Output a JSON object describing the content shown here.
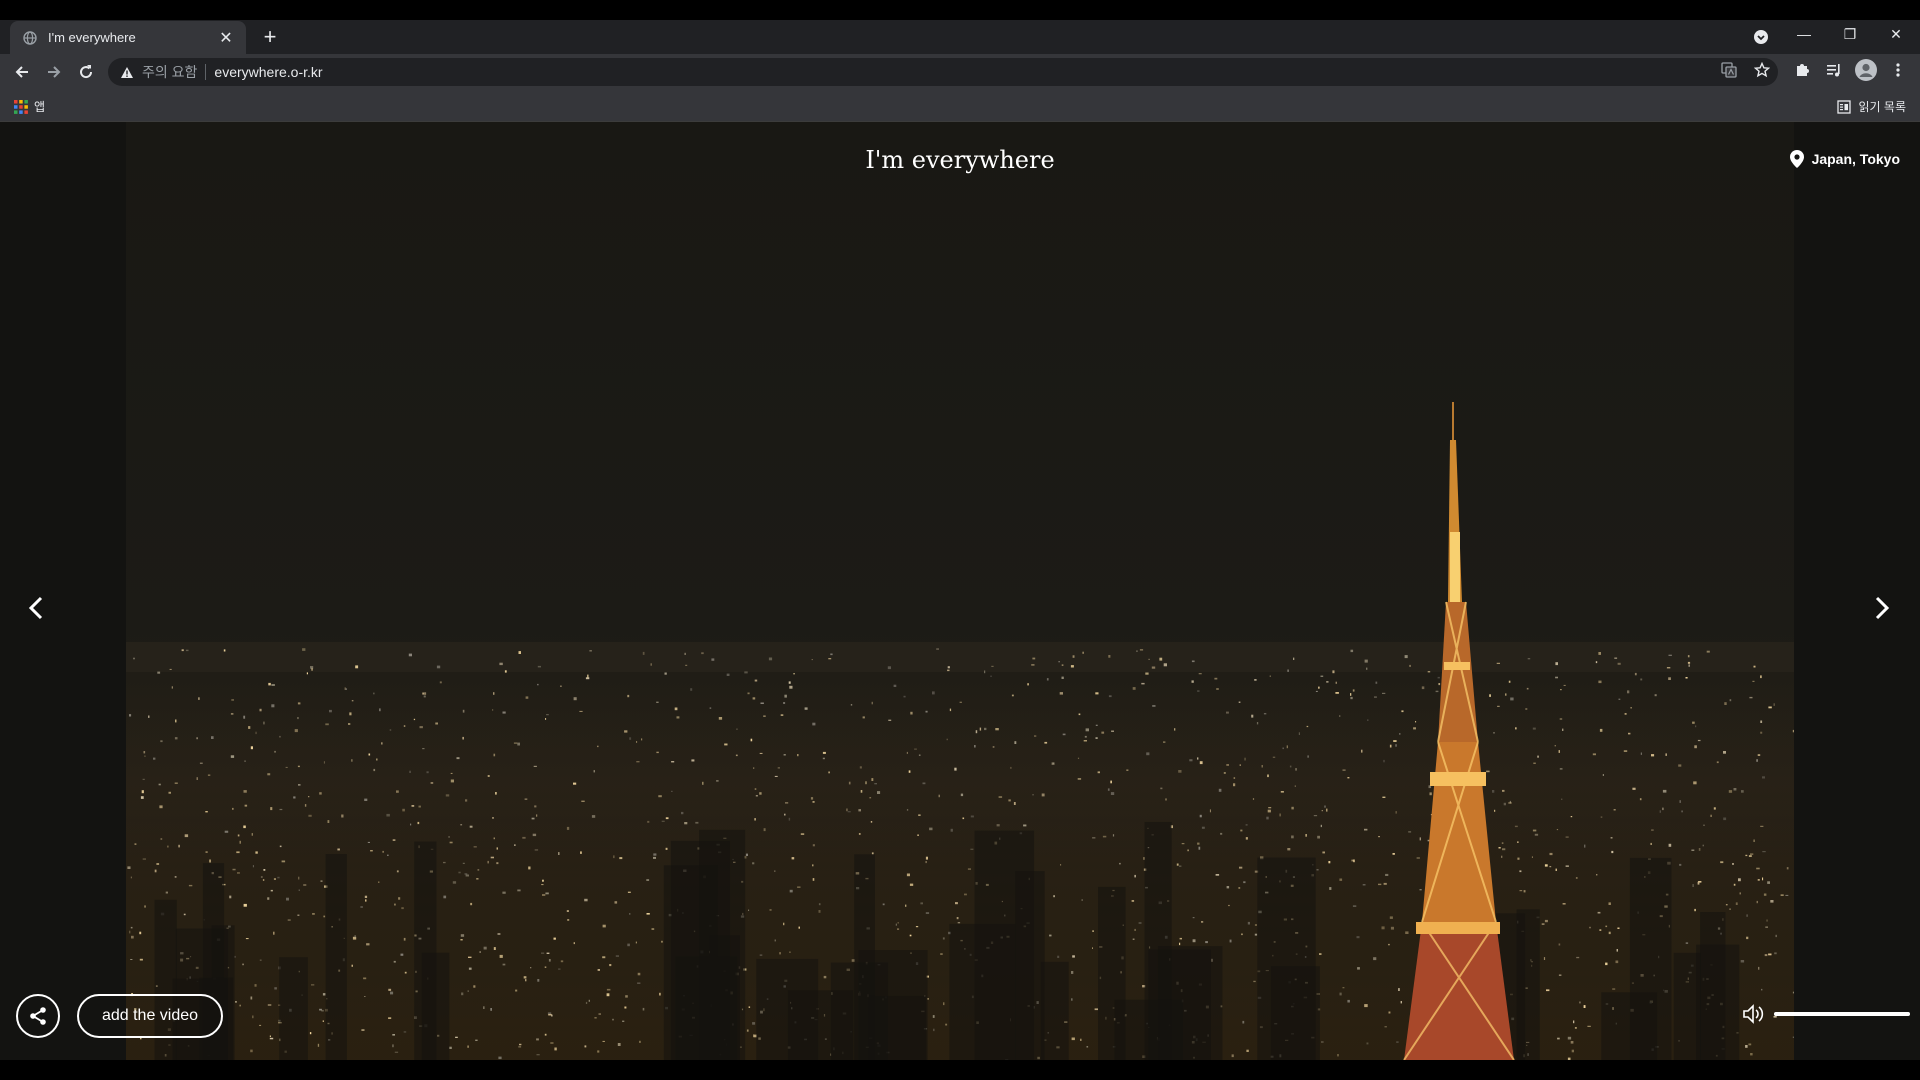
{
  "browser": {
    "tab": {
      "title": "I'm everywhere",
      "favicon": "globe-icon",
      "close_symbol": "✕"
    },
    "new_tab_symbol": "+",
    "window_controls": {
      "minimize": "—",
      "restore": "❐",
      "close": "✕"
    },
    "omnibox": {
      "security_label": "주의 요함",
      "url": "everywhere.o-r.kr"
    },
    "bookmarks_bar": {
      "apps_label": "앱",
      "reading_list_label": "읽기 목록"
    }
  },
  "page": {
    "title": "I'm everywhere",
    "location": "Japan, Tokyo",
    "add_video_label": "add the video",
    "volume_level": 1.0,
    "colors": {
      "background": "#131311",
      "text": "#ffffff",
      "tower_light": "#f0a030"
    }
  }
}
